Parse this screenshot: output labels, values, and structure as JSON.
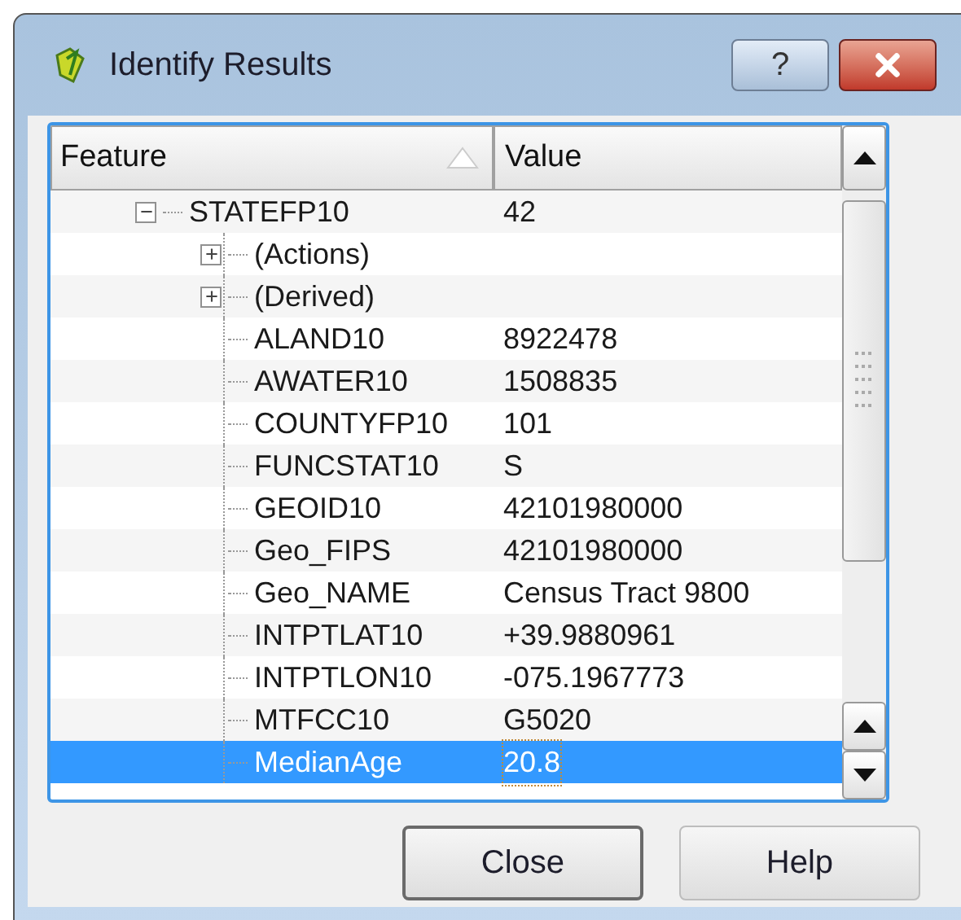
{
  "window": {
    "title": "Identify Results"
  },
  "title_buttons": [
    {
      "kind": "help",
      "label": "?"
    },
    {
      "kind": "close"
    }
  ],
  "tree": {
    "columns": [
      "Feature",
      "Value"
    ],
    "rows": [
      {
        "kind": "feature",
        "feature": "STATEFP10",
        "value": "42",
        "expanded": true,
        "selected": false,
        "children": [
          {
            "kind": "group",
            "feature": "(Actions)",
            "expanded": false,
            "selected": false
          },
          {
            "kind": "group",
            "feature": "(Derived)",
            "expanded": false,
            "selected": false
          },
          {
            "kind": "field",
            "feature": "ALAND10",
            "value": "8922478",
            "selected": false
          },
          {
            "kind": "field",
            "feature": "AWATER10",
            "value": "1508835",
            "selected": false
          },
          {
            "kind": "field",
            "feature": "COUNTYFP10",
            "value": "101",
            "selected": false
          },
          {
            "kind": "field",
            "feature": "FUNCSTAT10",
            "value": "S",
            "selected": false
          },
          {
            "kind": "field",
            "feature": "GEOID10",
            "value": "42101980000",
            "selected": false
          },
          {
            "kind": "field",
            "feature": "Geo_FIPS",
            "value": "42101980000",
            "selected": false
          },
          {
            "kind": "field",
            "feature": "Geo_NAME",
            "value": "Census Tract 9800",
            "selected": false
          },
          {
            "kind": "field",
            "feature": "INTPTLAT10",
            "value": "+39.9880961",
            "selected": false
          },
          {
            "kind": "field",
            "feature": "INTPTLON10",
            "value": "-075.1967773",
            "selected": false
          },
          {
            "kind": "field",
            "feature": "MTFCC10",
            "value": "G5020",
            "selected": false
          },
          {
            "kind": "field",
            "feature": "MedianAge",
            "value": "20.8",
            "selected": true
          }
        ]
      }
    ]
  },
  "buttons": [
    {
      "label": "Close",
      "default": true
    },
    {
      "label": "Help",
      "default": false
    }
  ]
}
